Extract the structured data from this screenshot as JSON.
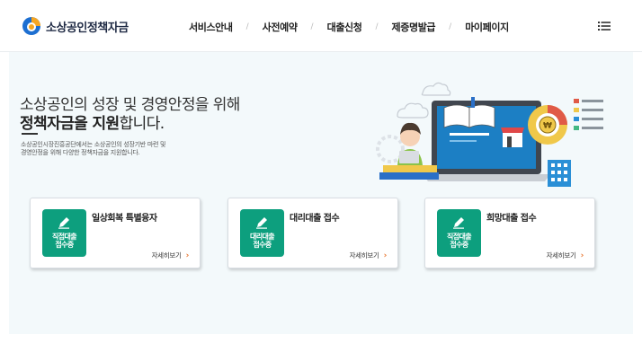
{
  "header": {
    "logo_text": "소상공인정책자금",
    "nav": [
      {
        "label": "서비스안내"
      },
      {
        "label": "사전예약"
      },
      {
        "label": "대출신청"
      },
      {
        "label": "제증명발급"
      },
      {
        "label": "마이페이지"
      }
    ],
    "menu_icon": "hamburger-list-icon"
  },
  "hero": {
    "title_line1": "소상공인의 성장 및 경영안정을 위해",
    "title_line2_bold": "정책자금을 지원",
    "title_line2_rest": "합니다.",
    "desc_line1": "소상공인시장진흥공단에서는 소상공인의 성장기반 마련 및",
    "desc_line2": "경영안정을 위해 다양한 정책자금을 지원합니다."
  },
  "cards": [
    {
      "title": "일상회복 특별융자",
      "icon_text": "직접대출\n접수중",
      "more": "자세히보기"
    },
    {
      "title": "대리대출 접수",
      "icon_text": "대리대출\n접수중",
      "more": "자세히보기"
    },
    {
      "title": "희망대출 접수",
      "icon_text": "직접대출\n접수중",
      "more": "자세히보기"
    }
  ],
  "colors": {
    "accent_green": "#0d9f7e",
    "arrow_orange": "#e8732c",
    "main_bg": "#f3f9fb",
    "logo_blue": "#1d6fd1",
    "logo_orange": "#f5a623"
  }
}
